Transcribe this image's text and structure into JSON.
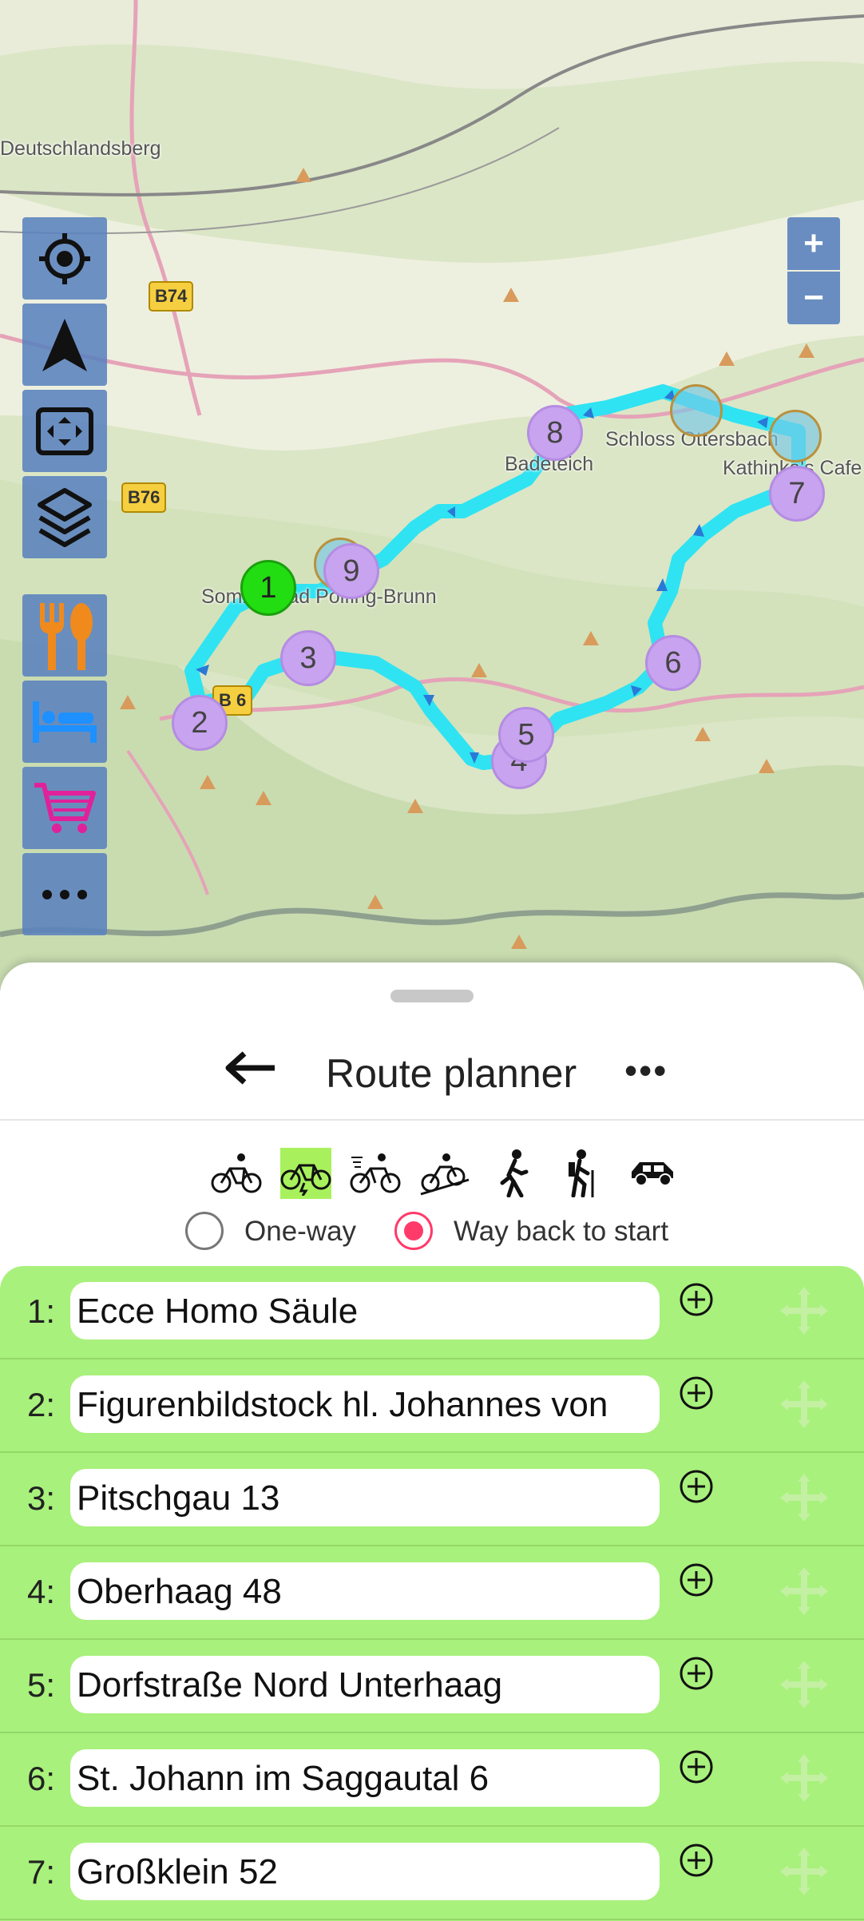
{
  "map": {
    "labels": {
      "deutschlandsberg": "Deutschlandsberg",
      "schloss": "Schloss Ottersbach",
      "kathinka": "Kathinka's Cafe",
      "badeteich": "Badeteich",
      "sommerbad": "Sommerbad Polfing-Brunn"
    },
    "roads": {
      "b74": "B74",
      "b76": "B76",
      "b7x": "B 6"
    },
    "markers": [
      "1",
      "2",
      "3",
      "4",
      "5",
      "6",
      "7",
      "8",
      "9"
    ],
    "zoom": {
      "in": "+",
      "out": "−"
    },
    "controls": [
      "locate-icon",
      "navigate-arrow-icon",
      "fit-bounds-icon",
      "layers-icon",
      "food-icon",
      "bed-icon",
      "shopping-cart-icon",
      "more-icon"
    ]
  },
  "sheet": {
    "title": "Route planner",
    "back_icon": "left-arrow-icon",
    "more": "•••",
    "modes": [
      "bike-icon",
      "ebike-icon",
      "road-bike-icon",
      "mtb-icon",
      "walk-icon",
      "hike-icon",
      "car-icon"
    ],
    "active_mode_color": "#a8f15d",
    "radio": {
      "one_way": "One-way",
      "way_back": "Way back to start",
      "selected": "way_back"
    }
  },
  "waypoints": [
    {
      "num": "1:",
      "name": "Ecce Homo Säule"
    },
    {
      "num": "2:",
      "name": "Figurenbildstock hl. Johannes von"
    },
    {
      "num": "3:",
      "name": "Pitschgau 13"
    },
    {
      "num": "4:",
      "name": "Oberhaag 48"
    },
    {
      "num": "5:",
      "name": "Dorfstraße Nord Unterhaag"
    },
    {
      "num": "6:",
      "name": "St. Johann im Saggautal 6"
    },
    {
      "num": "7:",
      "name": "Großklein 52"
    }
  ],
  "colors": {
    "route": "#2fe3f2",
    "list_bg": "#a8f17c",
    "radio_on": "#ff3b6a",
    "marker": "#c8a3ef",
    "start": "#22dd11"
  }
}
